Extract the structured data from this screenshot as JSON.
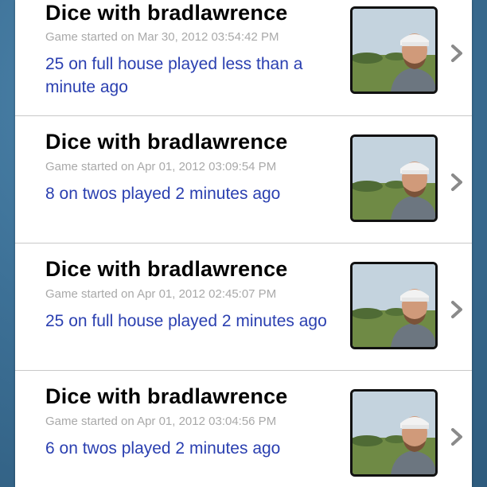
{
  "games": [
    {
      "title": "Dice with bradlawrence",
      "started": "Game started on Mar 30, 2012 03:54:42 PM",
      "played": "25 on full house played less than a minute ago"
    },
    {
      "title": "Dice with bradlawrence",
      "started": "Game started on Apr 01, 2012 03:09:54 PM",
      "played": "8 on twos played 2 minutes ago"
    },
    {
      "title": "Dice with bradlawrence",
      "started": "Game started on Apr 01, 2012 02:45:07 PM",
      "played": "25 on full house played 2 minutes ago"
    },
    {
      "title": "Dice with bradlawrence",
      "started": "Game started on Apr 01, 2012 03:04:56 PM",
      "played": "6 on twos played 2 minutes ago"
    }
  ],
  "icons": {
    "avatar": "user-photo",
    "disclosure": "chevron-right-icon"
  },
  "colors": {
    "title": "#000000",
    "started": "#a9a9a9",
    "played": "#2a3fb0",
    "background": "#3b6f94"
  }
}
